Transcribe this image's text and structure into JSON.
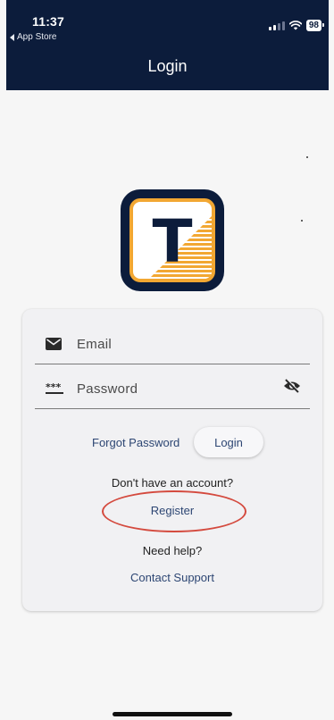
{
  "status_bar": {
    "time": "11:37",
    "back_label": "App Store",
    "battery": "98"
  },
  "header": {
    "title": "Login"
  },
  "colors": {
    "header_bg": "#0c1c3b",
    "accent_orange": "#f2a732",
    "link_blue": "#2d4673",
    "annotation_red": "#d44a3e"
  },
  "logo": {
    "letter": "T"
  },
  "form": {
    "email": {
      "placeholder": "Email",
      "value": "",
      "icon": "mail-icon"
    },
    "password": {
      "placeholder": "Password",
      "value": "",
      "icon": "password-dots-icon",
      "toggle_icon": "eye-off-icon"
    },
    "forgot_label": "Forgot Password",
    "login_label": "Login",
    "no_account_text": "Don't have an account?",
    "register_label": "Register",
    "help_text": "Need help?",
    "support_label": "Contact Support"
  }
}
